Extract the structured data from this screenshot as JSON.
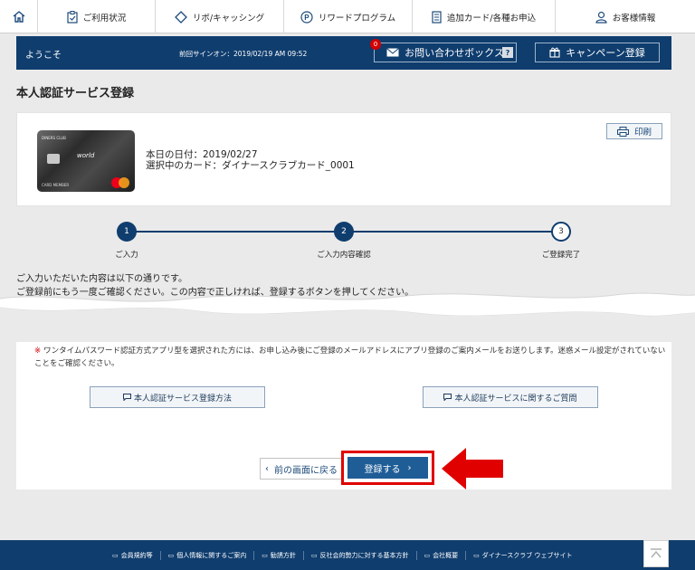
{
  "nav": {
    "items": [
      {
        "label": "ご利用状況",
        "icon": "clipboard-check-icon"
      },
      {
        "label": "リボ/キャッシング",
        "icon": "diamond-icon"
      },
      {
        "label": "リワードプログラム",
        "icon": "p-circle-icon"
      },
      {
        "label": "追加カード/各種お申込",
        "icon": "document-icon"
      },
      {
        "label": "お客様情報",
        "icon": "person-icon"
      }
    ]
  },
  "welcome": {
    "greeting": "ようこそ",
    "last_signin": "前回サインオン：2019/02/19 AM 09:52",
    "inquiry_label": "お問い合わせボックス",
    "inquiry_count": "0",
    "help_label": "?",
    "campaign_label": "キャンペーン登録"
  },
  "page": {
    "title": "本人認証サービス登録"
  },
  "card": {
    "date_line": "本日の日付：2019/02/27",
    "card_line": "選択中のカード：ダイナースクラブカード_0001",
    "print_label": "印刷",
    "card_brand_text": "world",
    "card_member_text": "CARD MEMBER",
    "card_issuer_text": "DINERS CLUB"
  },
  "steps": [
    {
      "number": "1",
      "label": "ご入力"
    },
    {
      "number": "2",
      "label": "ご入力内容確認"
    },
    {
      "number": "3",
      "label": "ご登録完了"
    }
  ],
  "intro": {
    "line1": "ご入力いただいた内容は以下の通りです。",
    "line2": "ご登録前にもう一度ご確認ください。この内容で正しければ、登録するボタンを押してください。"
  },
  "notice": {
    "mark": "※",
    "text": "ワンタイムパスワード認証方式アプリ型を選択された方には、お申し込み後にご登録のメールアドレスにアプリ登録のご案内メールをお送りします。迷惑メール設定がされていないことをご確認ください。"
  },
  "links": {
    "howto": "本人認証サービス登録方法",
    "faq": "本人認証サービスに関するご質問"
  },
  "form": {
    "back_label": "前の画面に戻る",
    "submit_label": "登録する"
  },
  "footer": {
    "links": [
      "会員規約等",
      "個人情報に関するご案内",
      "勧誘方針",
      "反社会的勢力に対する基本方針",
      "会社概要",
      "ダイナースクラブ ウェブサイト"
    ]
  },
  "colors": {
    "navy": "#0f3d6e",
    "accent_red": "#e00000",
    "submit_blue": "#1f5d97"
  }
}
